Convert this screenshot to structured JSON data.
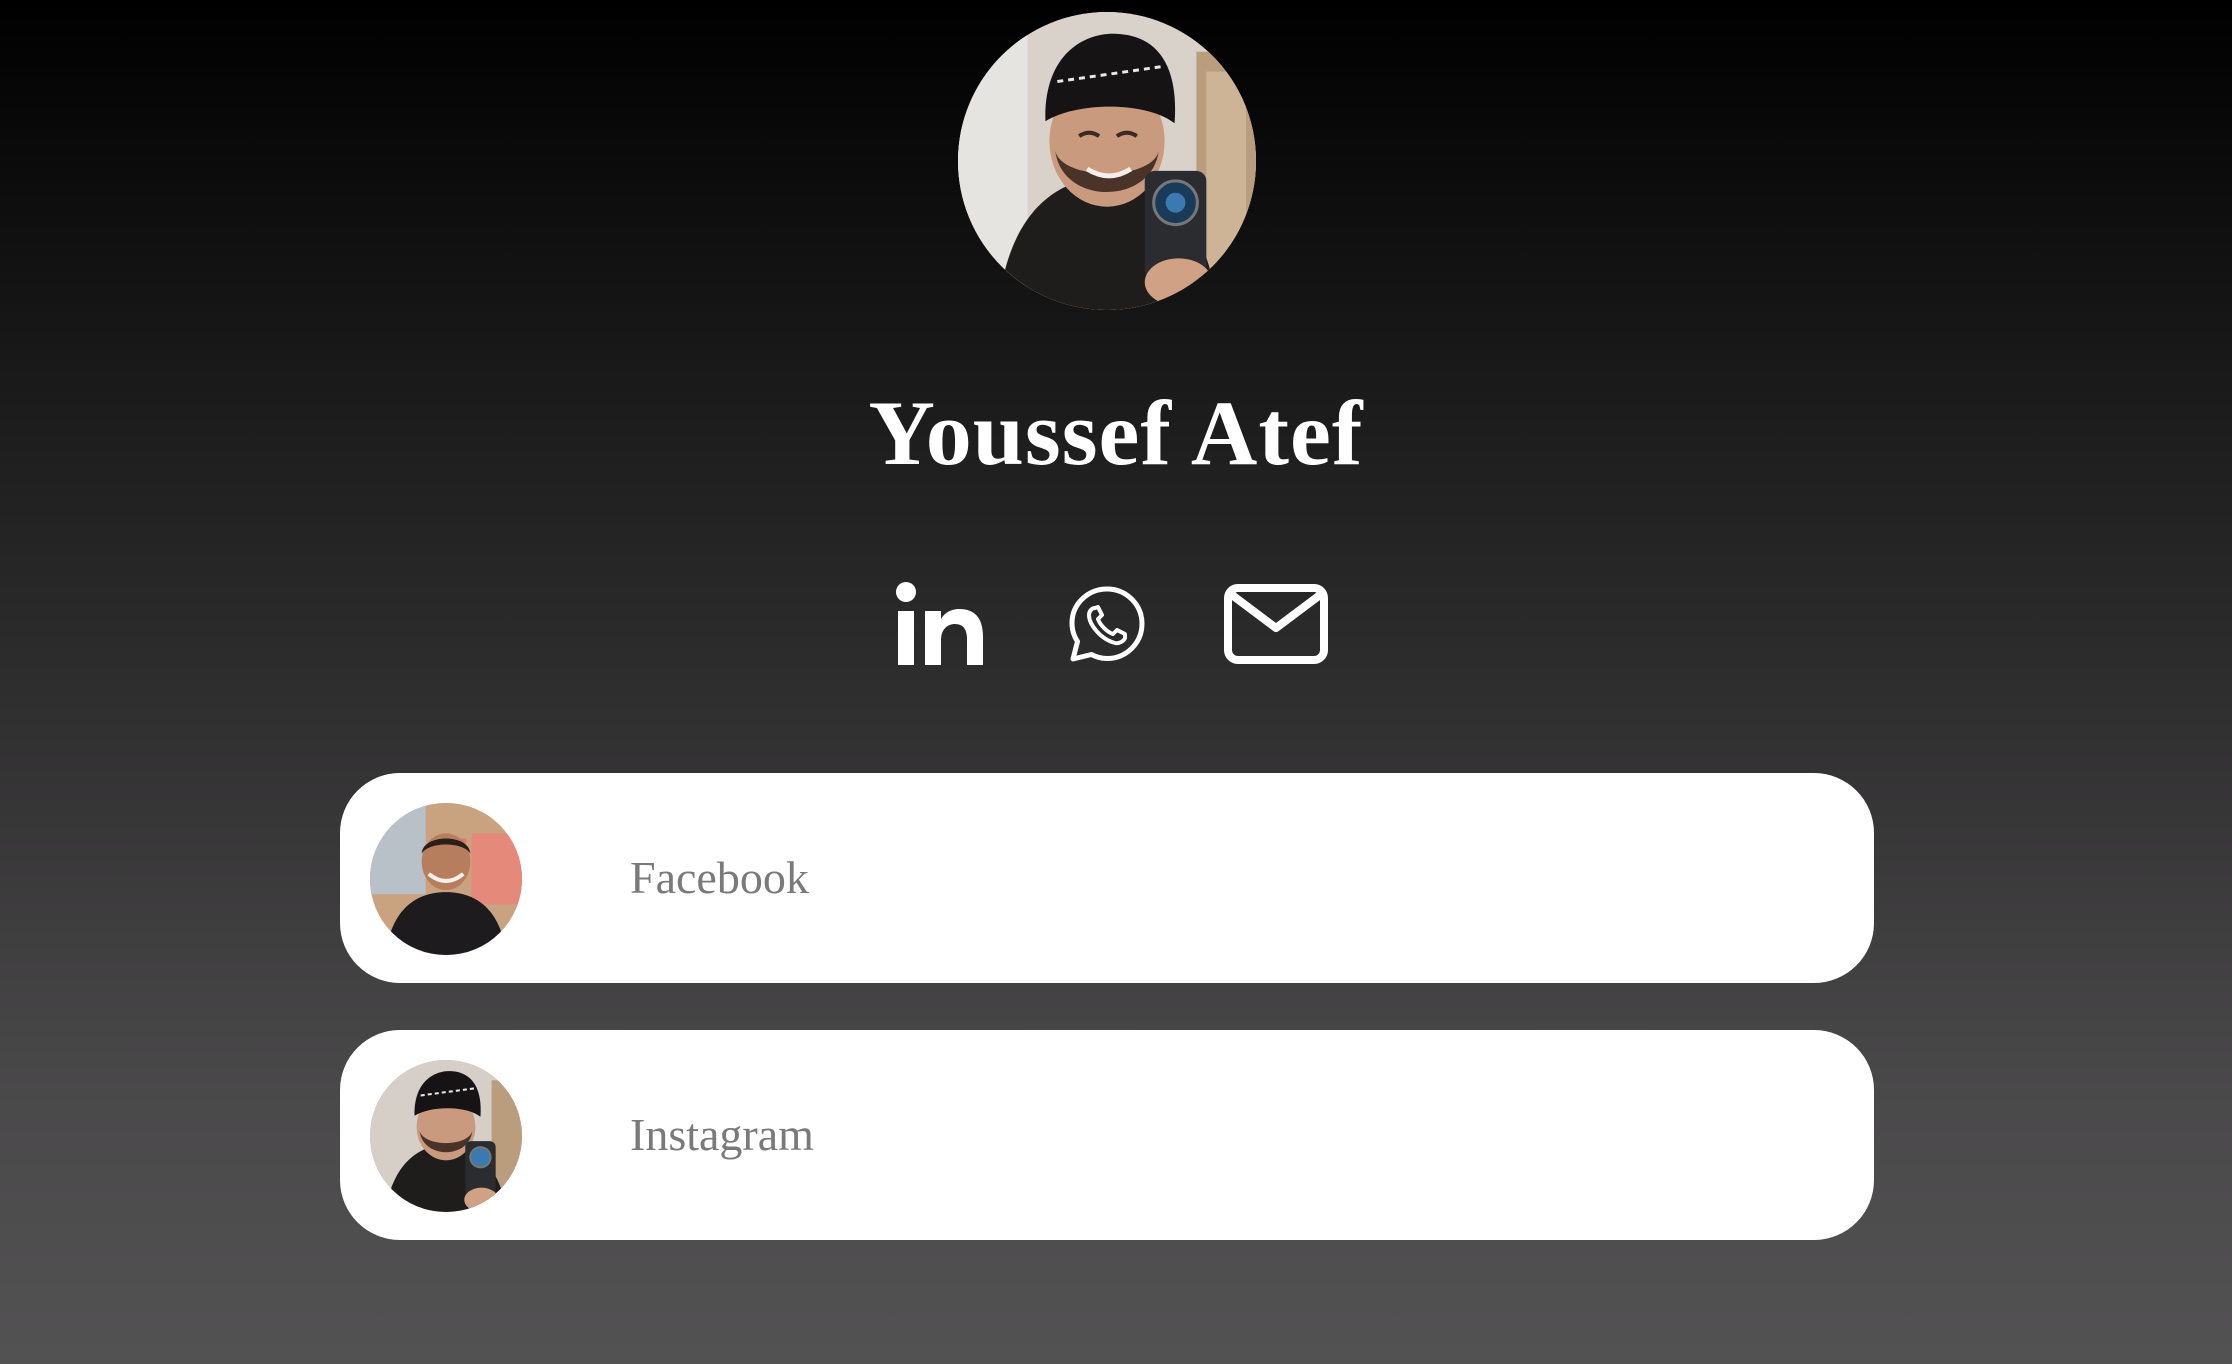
{
  "profile": {
    "name": "Youssef Atef",
    "avatar_icon": "profile-photo"
  },
  "social_links": [
    {
      "icon": "linkedin-icon",
      "label": "LinkedIn"
    },
    {
      "icon": "whatsapp-icon",
      "label": "WhatsApp"
    },
    {
      "icon": "email-icon",
      "label": "Email"
    }
  ],
  "links": [
    {
      "label": "Facebook",
      "thumbnail": "profile-photo-smiling"
    },
    {
      "label": "Instagram",
      "thumbnail": "profile-photo-selfie"
    }
  ],
  "colors": {
    "background_top": "#000000",
    "background_bottom": "#535253",
    "card": "#ffffff",
    "card_text": "#7a7a7a",
    "name_text": "#ffffff",
    "icon": "#ffffff"
  }
}
